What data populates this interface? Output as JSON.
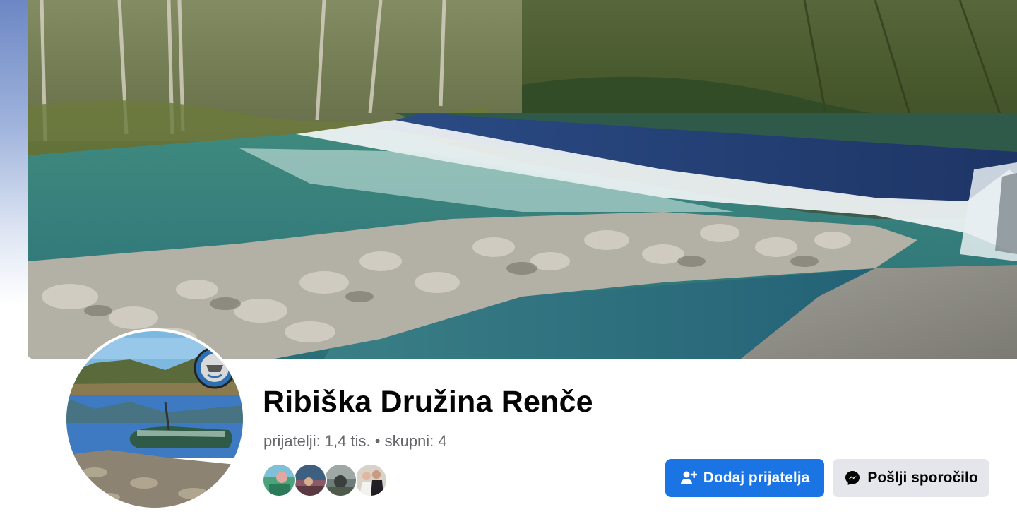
{
  "profile": {
    "name": "Ribiška Družina Renče",
    "friends_text": "prijatelji: 1,4 tis.",
    "separator": "•",
    "mutual_text": "skupni: 4"
  },
  "mutual_friends": [
    {
      "icon": "friend-avatar-1"
    },
    {
      "icon": "friend-avatar-2"
    },
    {
      "icon": "friend-avatar-3"
    },
    {
      "icon": "friend-avatar-4"
    }
  ],
  "actions": {
    "add_friend_label": "Dodaj prijatelja",
    "add_friend_icon": "add-person-icon",
    "message_label": "Pošlji sporočilo",
    "message_icon": "messenger-icon"
  },
  "colors": {
    "primary_button": "#1b74e4",
    "secondary_button": "#e4e6eb",
    "name_text": "#050505",
    "meta_text": "#65676b"
  }
}
